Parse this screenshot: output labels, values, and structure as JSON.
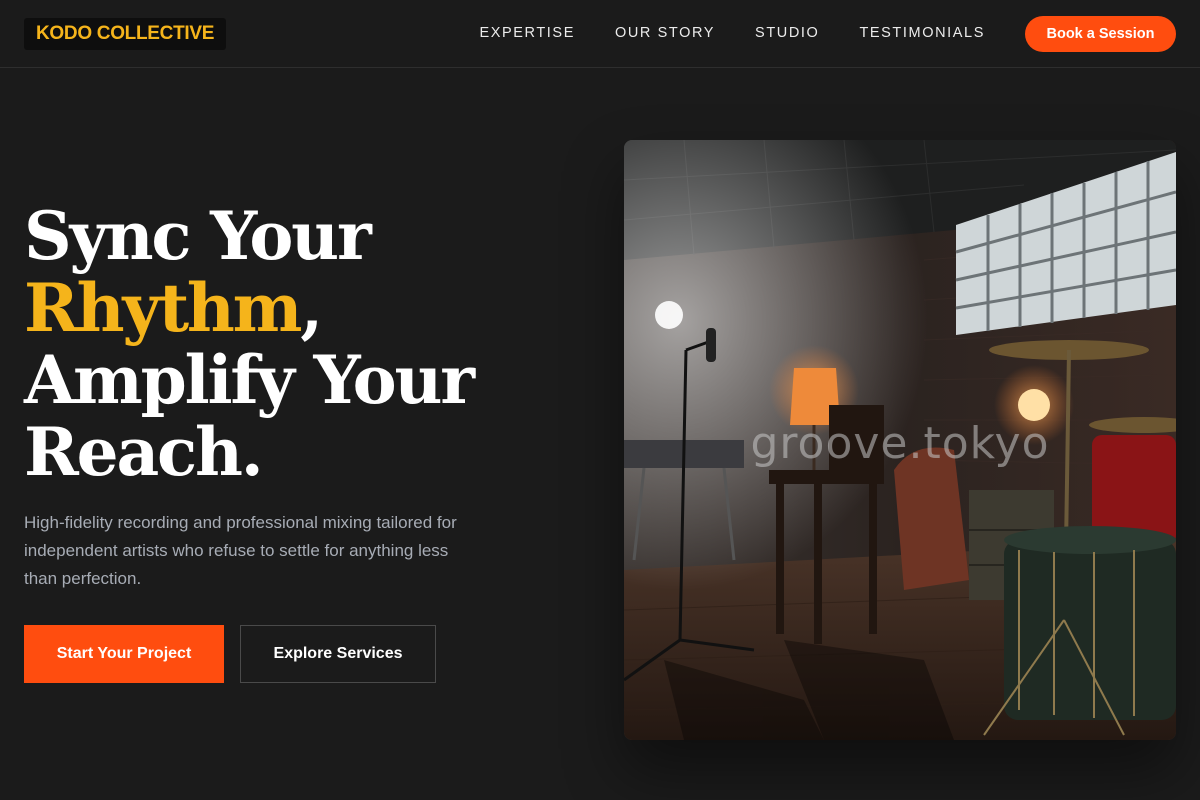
{
  "brand": {
    "name": "KODO COLLECTIVE"
  },
  "nav": {
    "links": [
      "EXPERTISE",
      "OUR STORY",
      "STUDIO",
      "TESTIMONIALS"
    ],
    "cta": "Book a Session"
  },
  "hero": {
    "title_line1": "Sync Your",
    "title_accent": "Rhythm",
    "title_comma": ",",
    "title_line3": "Amplify Your",
    "title_line4": "Reach.",
    "subtitle": "High-fidelity recording and professional mixing tailored for independent artists who refuse to settle for anything less than perfection.",
    "primary_button": "Start Your Project",
    "secondary_button": "Explore Services"
  },
  "image": {
    "subject": "recording studio room with drum kit, microphone stand, lamps and glass-block window",
    "watermark": "groove.tokyo"
  },
  "colors": {
    "background": "#1b1b1b",
    "accent_orange": "#ff4d0f",
    "accent_yellow": "#f5b41b",
    "subtitle_gray": "#a7acb5"
  }
}
